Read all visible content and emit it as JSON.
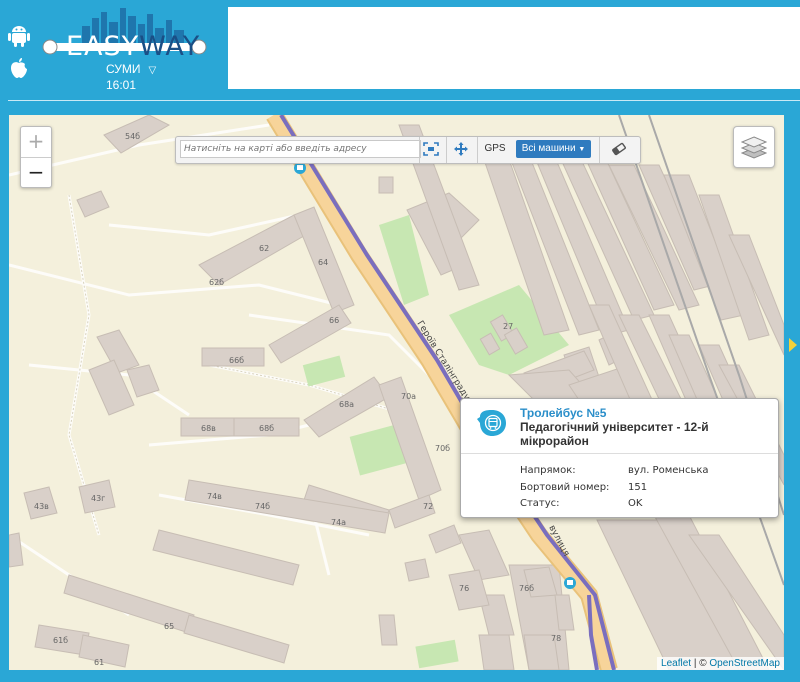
{
  "header": {
    "logo": {
      "easy": "EASY",
      "way": "WAY"
    },
    "city": "СУМИ",
    "time": "16:01"
  },
  "icons": {
    "android": "android-icon",
    "apple": "apple-icon",
    "fit": "fit-bounds-icon",
    "move": "move-icon",
    "eraser": "eraser-icon",
    "layers": "layers-icon",
    "trolley": "trolleybus-icon"
  },
  "map": {
    "zoom_in": "+",
    "zoom_out": "−",
    "search_placeholder": "Натисніть на карті або введіть адресу",
    "gps_label": "GPS",
    "vehicles_label": "Всі машини",
    "street_labels": [
      "Героїв Сталінграду вулиця",
      "вулиця"
    ],
    "building_labels": [
      "54б",
      "62",
      "64",
      "62б",
      "66",
      "66б",
      "27",
      "68а",
      "70а",
      "68в",
      "68б",
      "70б",
      "72",
      "43в",
      "43г",
      "74в",
      "74б",
      "74а",
      "76б",
      "76",
      "78",
      "65",
      "61б",
      "61"
    ],
    "colors": {
      "background": "#f4f0dc",
      "building": "#d9d0c9",
      "green": "#c7e7b2",
      "road_major": "#f7c873",
      "route": "#7a6ebe",
      "header": "#2aa7d6"
    }
  },
  "popup": {
    "title": "Тролейбус №5",
    "stop": "Педагогічний університет - 12-й мікрорайон",
    "direction_label": "Напрямок:",
    "direction_value": "вул. Роменська",
    "board_label": "Бортовий номер:",
    "board_value": "151",
    "status_label": "Статус:",
    "status_value": "OK"
  },
  "attribution": {
    "leaflet": "Leaflet",
    "sep": " | © ",
    "osm": "OpenStreetMap"
  }
}
